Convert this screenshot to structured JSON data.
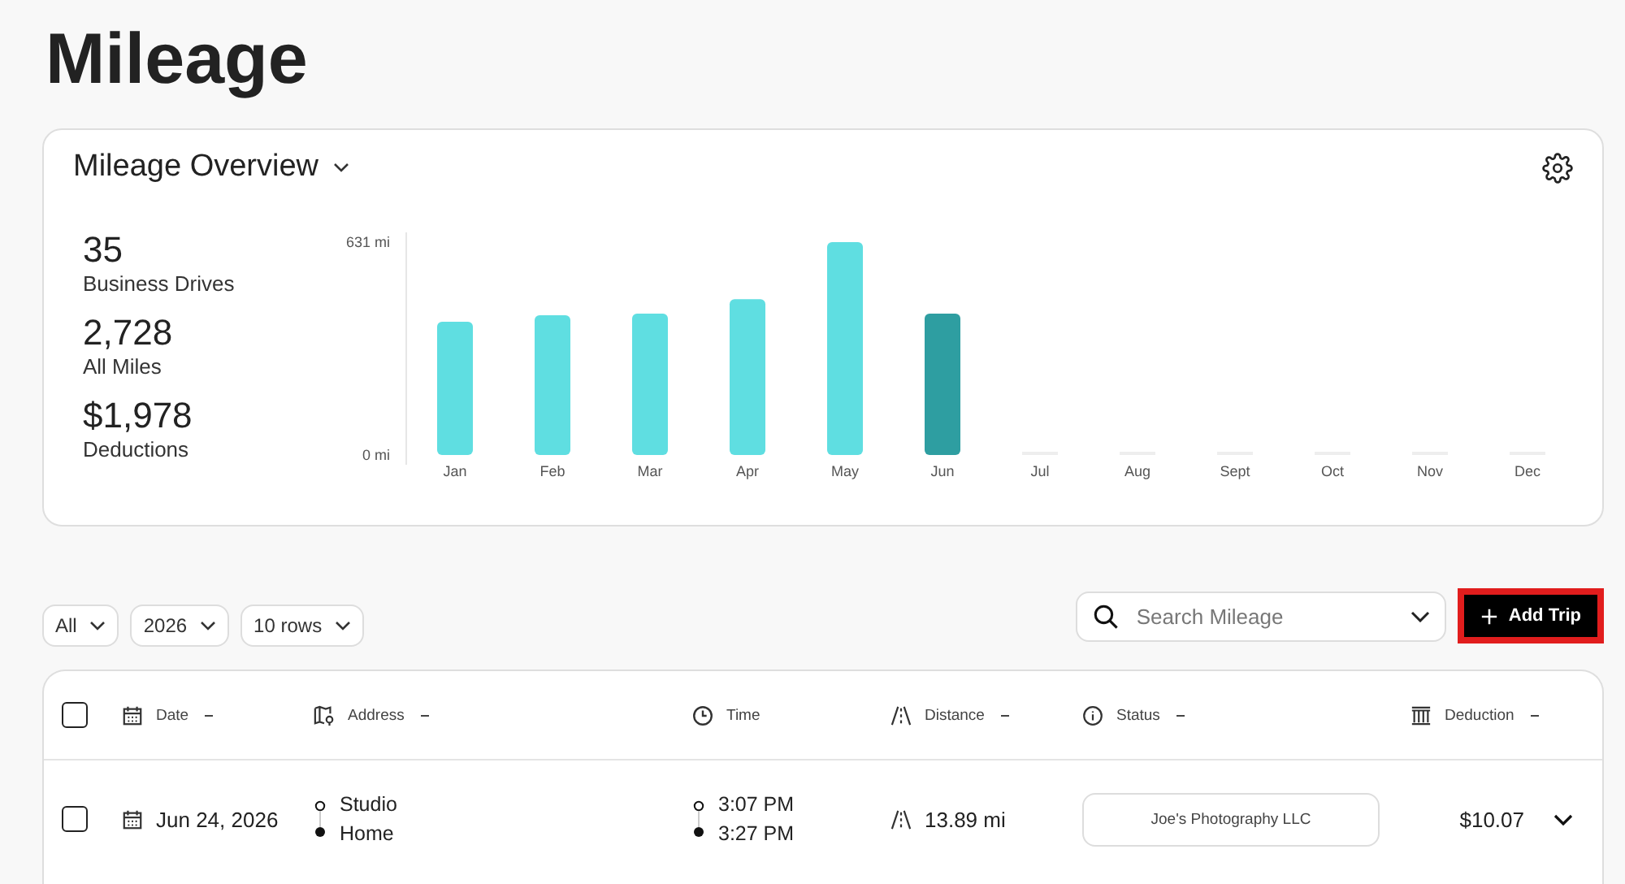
{
  "page_title": "Mileage",
  "overview": {
    "title": "Mileage Overview",
    "stats": [
      {
        "value": "35",
        "label": "Business Drives"
      },
      {
        "value": "2,728",
        "label": "All Miles"
      },
      {
        "value": "$1,978",
        "label": "Deductions"
      }
    ],
    "chart_data": {
      "type": "bar",
      "categories": [
        "Jan",
        "Feb",
        "Mar",
        "Apr",
        "May",
        "Jun",
        "Jul",
        "Aug",
        "Sept",
        "Oct",
        "Nov",
        "Dec"
      ],
      "series": [
        {
          "color": "#5fdee1",
          "values": [
            395,
            414,
            419,
            462,
            631,
            null,
            0,
            0,
            0,
            0,
            0,
            0
          ]
        },
        {
          "color": "#2e9ea1",
          "values": [
            null,
            null,
            null,
            null,
            null,
            419,
            null,
            null,
            null,
            null,
            null,
            null
          ]
        }
      ],
      "stacked": true,
      "ylim": [
        0,
        631
      ],
      "yticks": [
        {
          "value": 0,
          "label": "0 mi"
        },
        {
          "value": 631,
          "label": "631 mi"
        }
      ]
    }
  },
  "filters": [
    {
      "label": "All"
    },
    {
      "label": "2026"
    },
    {
      "label": "10 rows"
    }
  ],
  "search": {
    "placeholder": "Search Mileage"
  },
  "add_button": {
    "label": "Add Trip",
    "outlined": true
  },
  "table": {
    "select_all_checked": false,
    "columns": [
      {
        "label": "Date",
        "sortable": true
      },
      {
        "label": "Address",
        "sortable": true
      },
      {
        "label": "Time",
        "sortable": false
      },
      {
        "label": "Distance",
        "sortable": true
      },
      {
        "label": "Status",
        "sortable": true
      },
      {
        "label": "Deduction",
        "sortable": true
      }
    ],
    "rows": [
      {
        "checked": false,
        "date": "Jun 24, 2026",
        "from": "Studio",
        "to": "Home",
        "start_time": "3:07 PM",
        "end_time": "3:27 PM",
        "distance": "13.89 mi",
        "status": "Joe's Photography LLC",
        "deduction": "$10.07",
        "expanded": false
      }
    ]
  }
}
